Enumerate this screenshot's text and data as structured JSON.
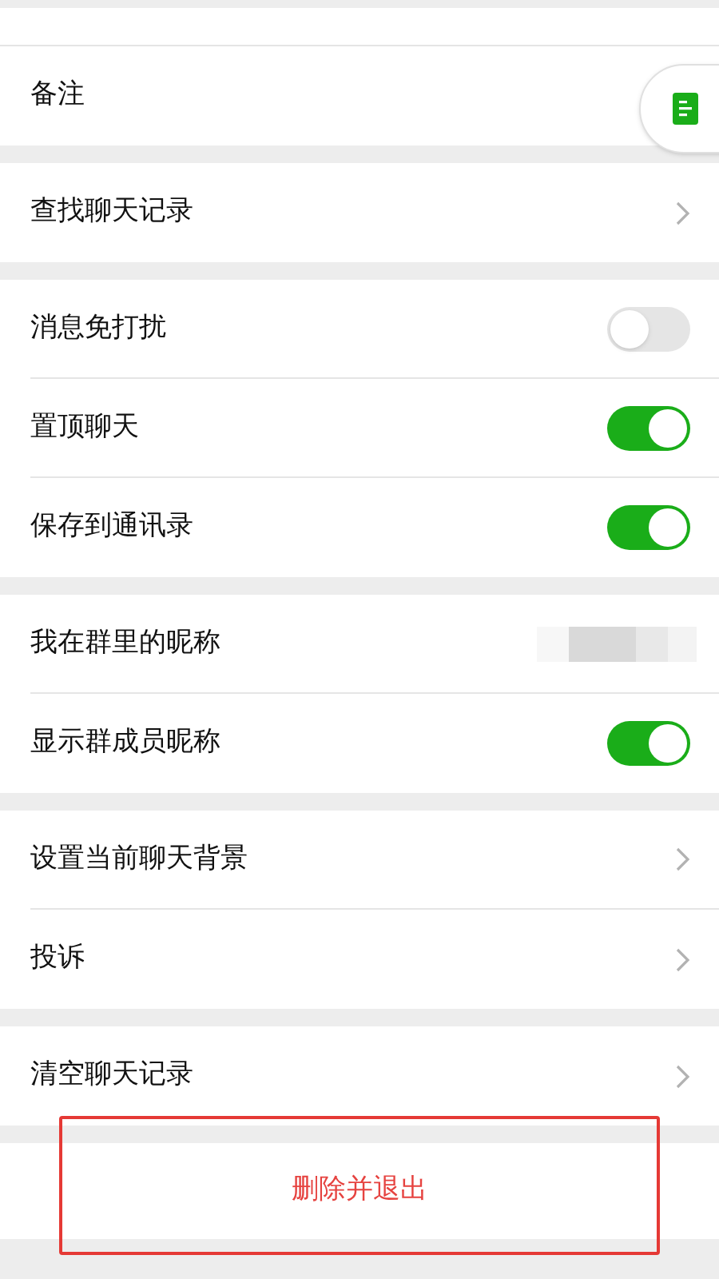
{
  "sections": [
    {
      "items": [
        {
          "kind": "plain",
          "label": "备注"
        }
      ]
    },
    {
      "items": [
        {
          "kind": "nav",
          "label": "查找聊天记录"
        }
      ]
    },
    {
      "items": [
        {
          "kind": "toggle",
          "label": "消息免打扰",
          "on": false
        },
        {
          "kind": "toggle",
          "label": "置顶聊天",
          "on": true
        },
        {
          "kind": "toggle",
          "label": "保存到通讯录",
          "on": true
        }
      ]
    },
    {
      "items": [
        {
          "kind": "hidden",
          "label": "我在群里的昵称"
        },
        {
          "kind": "toggle",
          "label": "显示群成员昵称",
          "on": true
        }
      ]
    },
    {
      "items": [
        {
          "kind": "nav",
          "label": "设置当前聊天背景"
        },
        {
          "kind": "nav",
          "label": "投诉"
        }
      ]
    },
    {
      "items": [
        {
          "kind": "nav",
          "label": "清空聊天记录"
        }
      ]
    }
  ],
  "delete_button": {
    "label": "删除并退出",
    "highlighted": true
  }
}
